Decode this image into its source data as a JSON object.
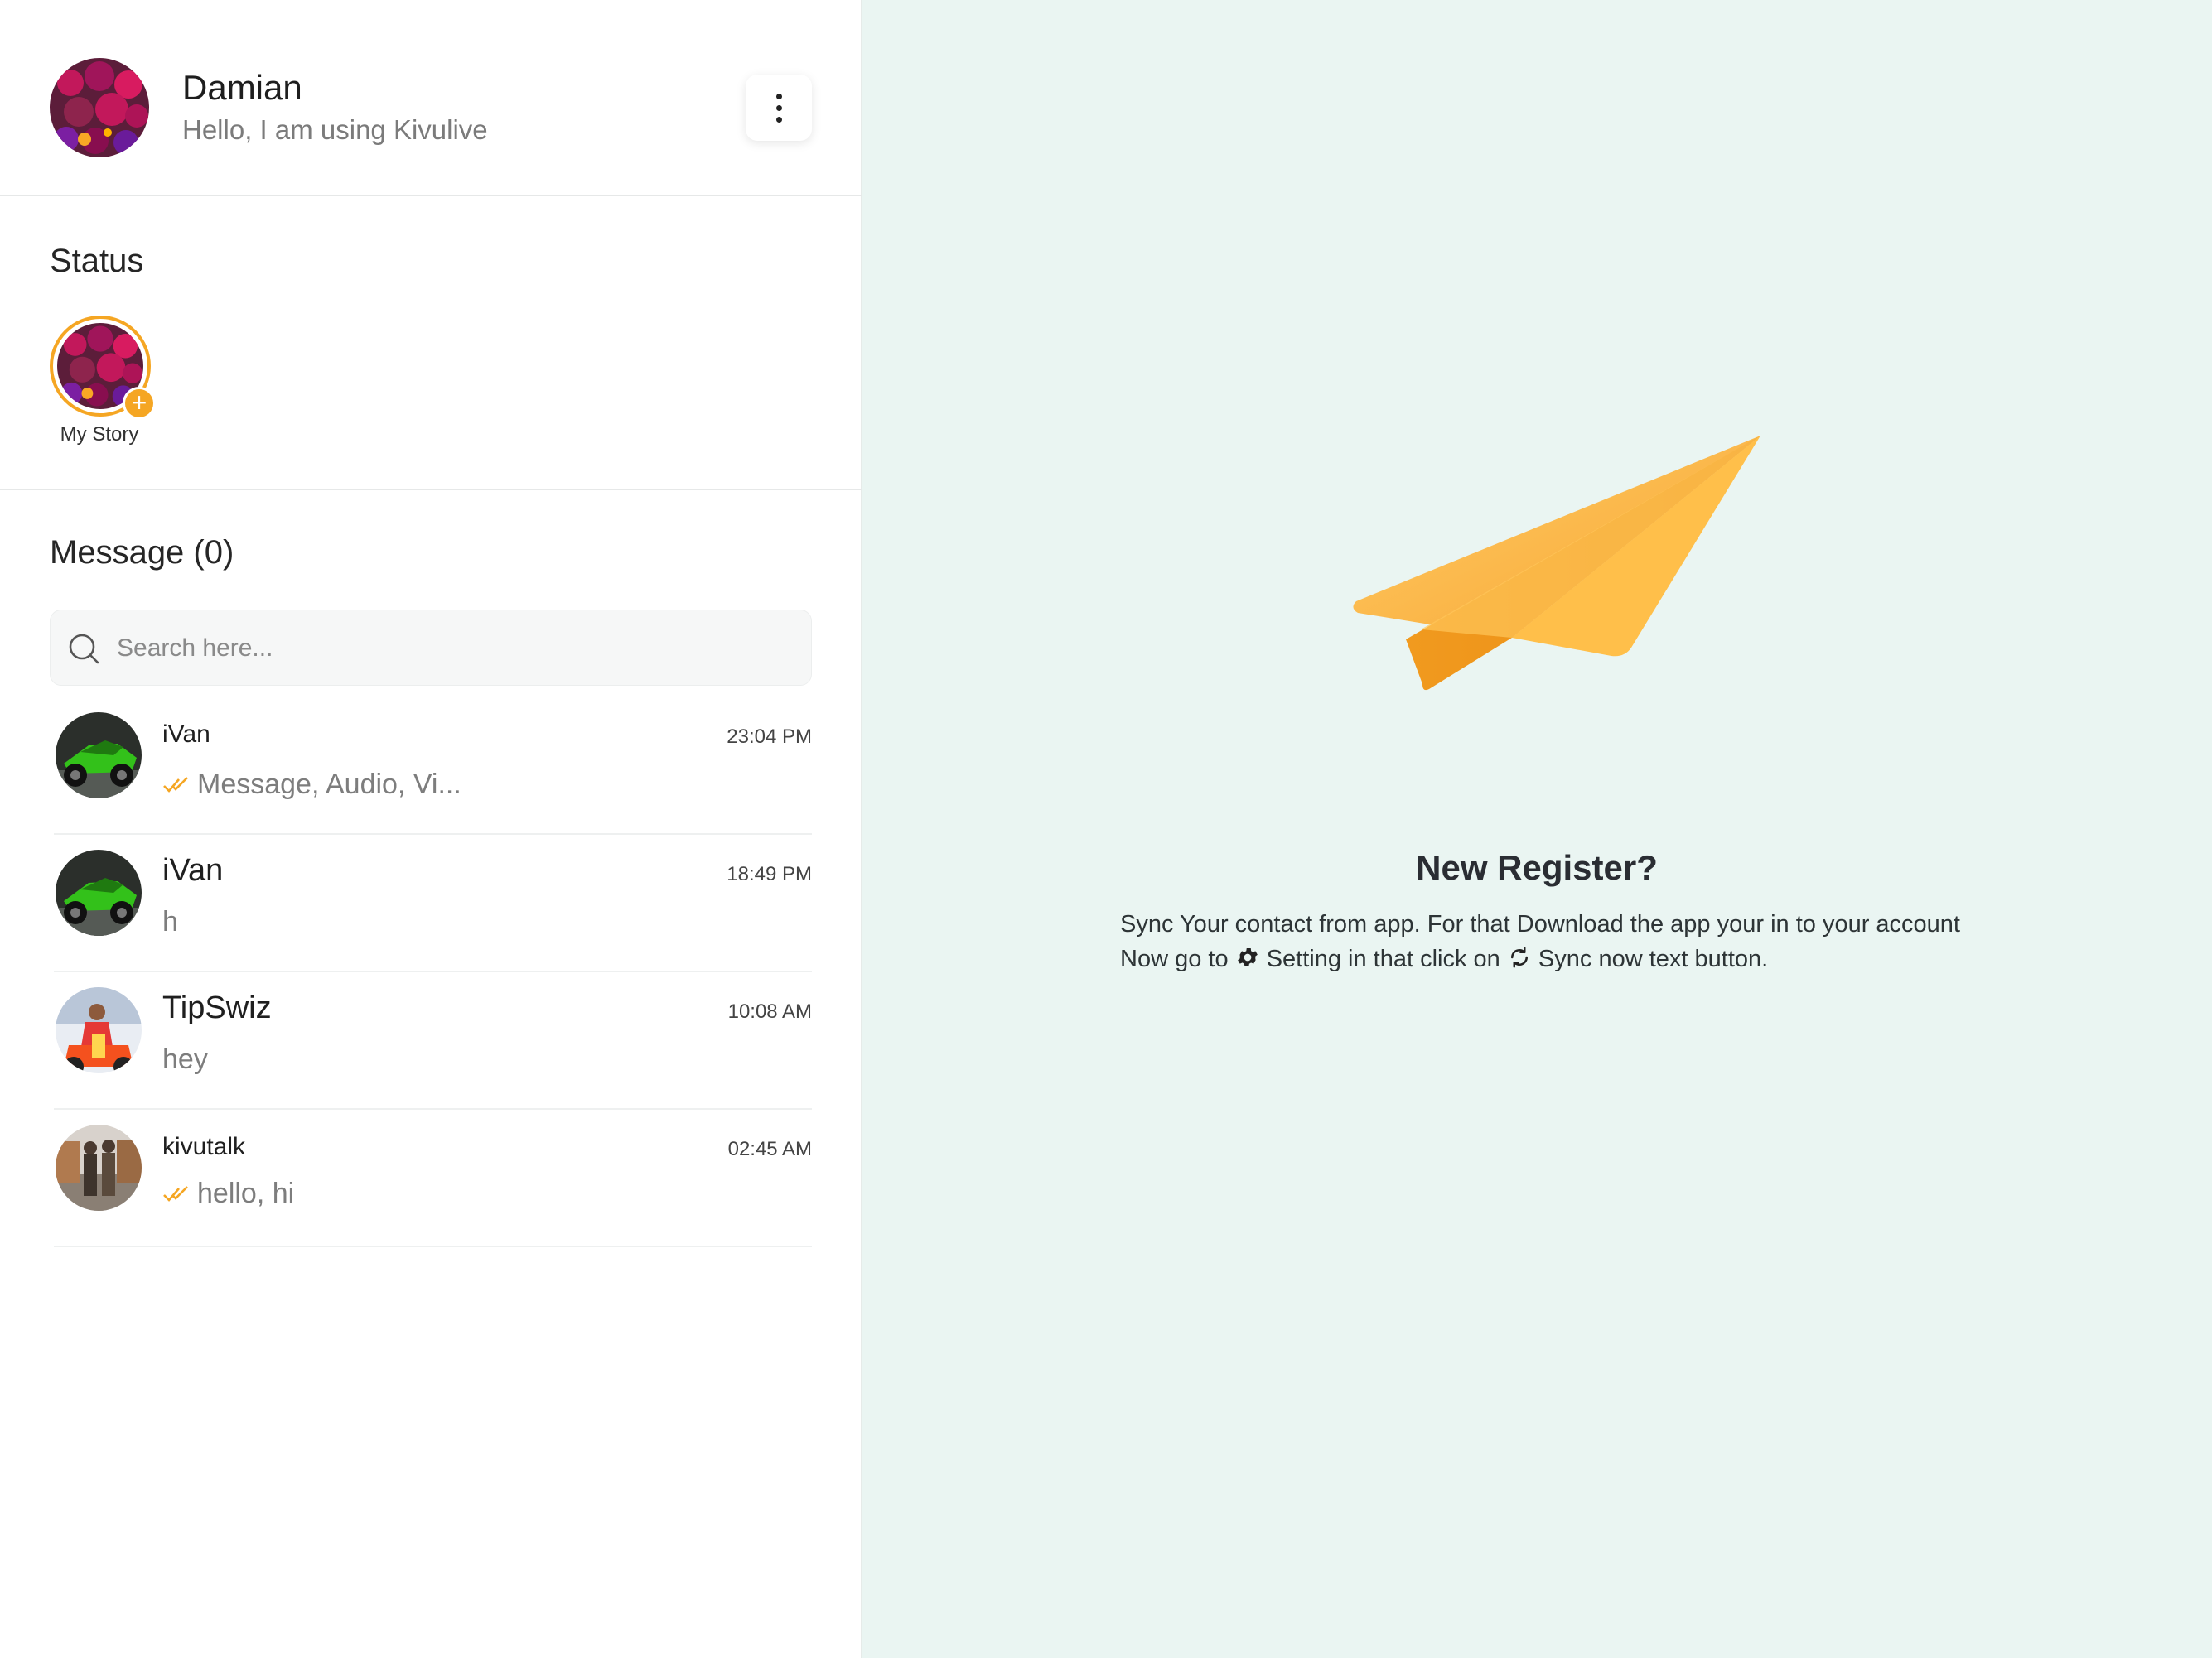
{
  "profile": {
    "name": "Damian",
    "about": "Hello, I am using Kivulive"
  },
  "status": {
    "title": "Status",
    "my_story_label": "My Story"
  },
  "messages": {
    "title": "Message (0)",
    "search_placeholder": "Search here...",
    "chats": [
      {
        "name": "iVan",
        "time": "23:04 PM",
        "preview": "Message, Audio, Vi...",
        "read": true
      },
      {
        "name": "iVan",
        "time": "18:49 PM",
        "preview": "h",
        "read": false
      },
      {
        "name": "TipSwiz",
        "time": "10:08 AM",
        "preview": "hey",
        "read": false
      },
      {
        "name": "kivutalk",
        "time": "02:45 AM",
        "preview": "hello, hi",
        "read": true
      }
    ]
  },
  "empty_state": {
    "title": "New Register?",
    "line1": "Sync Your contact from app. For that Download the app your in to your account",
    "line2_a": "Now go to",
    "line2_b": " Setting in that click on ",
    "line2_c": " Sync now text button."
  },
  "colors": {
    "accent": "#f5a623",
    "main_bg": "#eaf5f2"
  },
  "icons": [
    "more-vertical-icon",
    "search-icon",
    "double-check-icon",
    "gear-icon",
    "sync-icon",
    "paper-plane-icon",
    "plus-icon"
  ]
}
